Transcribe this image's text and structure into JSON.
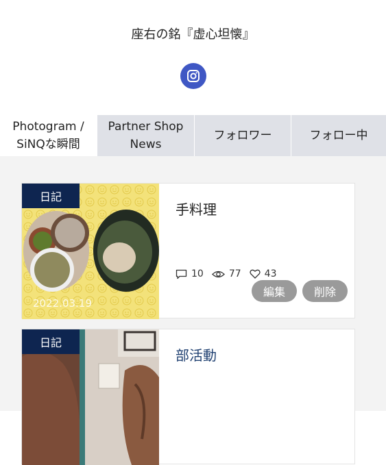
{
  "profile": {
    "motto": "座右の銘『虚心坦懐』",
    "instagram_icon": "instagram-icon"
  },
  "tabs": [
    {
      "line1": "Photogram /",
      "line2": "SiNQな瞬間",
      "active": true
    },
    {
      "line1": "Partner Shop",
      "line2": "News",
      "active": false
    },
    {
      "line1": "フォロワー",
      "line2": "",
      "active": false
    },
    {
      "line1": "フォロー中",
      "line2": "",
      "active": false
    }
  ],
  "posts": [
    {
      "category": "日記",
      "title": "手料理",
      "date": "2022.03.19",
      "comments": "10",
      "views": "77",
      "likes": "43",
      "edit_label": "編集",
      "delete_label": "削除"
    },
    {
      "category": "日記",
      "title": "部活動"
    }
  ],
  "colors": {
    "badge": "#0e2550",
    "tab_inactive": "#dfe1e7",
    "instagram": "#3f57c4",
    "button": "#9a9a9a"
  }
}
